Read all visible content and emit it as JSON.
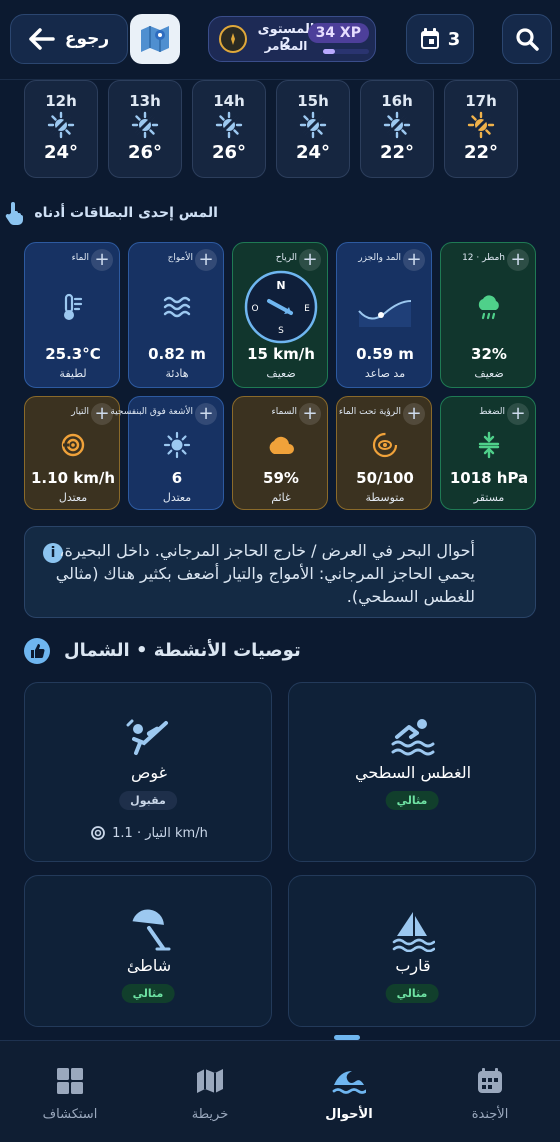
{
  "header": {
    "back_label": "رجوع",
    "level_label": "المستوى 2",
    "level_title": "المغامر",
    "xp": "34 XP",
    "xp_progress": 0.25,
    "calendar_count": "3"
  },
  "hourly": [
    {
      "hour": "12h",
      "temp": "24°",
      "icon": "partly-sunny-icon"
    },
    {
      "hour": "13h",
      "temp": "26°",
      "icon": "partly-sunny-icon"
    },
    {
      "hour": "14h",
      "temp": "26°",
      "icon": "partly-sunny-icon"
    },
    {
      "hour": "15h",
      "temp": "24°",
      "icon": "partly-sunny-icon"
    },
    {
      "hour": "16h",
      "temp": "22°",
      "icon": "partly-sunny-icon"
    },
    {
      "hour": "17h",
      "temp": "22°",
      "icon": "sun-icon"
    }
  ],
  "hint": "المس إحدى البطاقات أدناه",
  "metrics_row1": [
    {
      "name": "الماء",
      "value": "25.3°C",
      "sub": "لطيفة",
      "icon": "thermometer-icon",
      "color": "blue"
    },
    {
      "name": "الأمواج",
      "value": "0.82 m",
      "sub": "هادئة",
      "icon": "waves-icon",
      "color": "blue"
    },
    {
      "name": "الرياح",
      "value": "15 km/h",
      "sub": "ضعيف",
      "icon": "wind-compass-icon",
      "color": "green",
      "compass": {
        "n": "N",
        "e": "E",
        "s": "S",
        "o": "O"
      }
    },
    {
      "name": "المد والجزر",
      "value": "0.59 m",
      "sub": "مد صاعد",
      "icon": "tide-curve-icon",
      "color": "blue"
    },
    {
      "name": "مطر · 12h",
      "value": "32%",
      "sub": "ضعيف",
      "icon": "rain-cloud-icon",
      "color": "green"
    }
  ],
  "metrics_row2": [
    {
      "name": "التيار",
      "value": "1.10 km/h",
      "sub": "معتدل",
      "icon": "current-icon",
      "color": "amber"
    },
    {
      "name": "الأشعة فوق البنفسجية",
      "value": "6",
      "sub": "معتدل",
      "icon": "uv-sun-icon",
      "color": "blue"
    },
    {
      "name": "السماء",
      "value": "59%",
      "sub": "غائم",
      "icon": "cloud-icon",
      "color": "amber"
    },
    {
      "name": "الرؤية تحت الماء",
      "value": "50/100",
      "sub": "متوسطة",
      "icon": "eye-icon",
      "color": "amber"
    },
    {
      "name": "الضغط",
      "value": "1018 hPa",
      "sub": "مستقر",
      "icon": "pressure-icon",
      "color": "green"
    }
  ],
  "info_text": "أحوال البحر في العرض / خارج الحاجز المرجاني. داخل البحيرة، يحمي الحاجز المرجاني: الأمواج والتيار أضعف بكثير هناك (مثالي للغطس السطحي).",
  "section_title": "توصيات الأنشطة • الشمال",
  "activities": [
    {
      "name": "الغطس السطحي",
      "badge": "مثالي",
      "status": "ideal",
      "icon": "snorkel-swimmer-icon"
    },
    {
      "name": "غوص",
      "badge": "مقبول",
      "status": "ok",
      "icon": "diver-icon",
      "extra": "التيار · 1.1 km/h"
    },
    {
      "name": "قارب",
      "badge": "مثالي",
      "status": "ideal",
      "icon": "sailboat-icon"
    },
    {
      "name": "شاطئ",
      "badge": "مثالي",
      "status": "ideal",
      "icon": "beach-umbrella-icon"
    }
  ],
  "bottom_nav": [
    {
      "label": "الأجندة",
      "icon": "calendar-icon"
    },
    {
      "label": "الأحوال",
      "icon": "wave-icon",
      "active": true
    },
    {
      "label": "خريطة",
      "icon": "map-icon"
    },
    {
      "label": "استكشاف",
      "icon": "grid-icon"
    }
  ],
  "colors": {
    "background": "#0c1a30",
    "card_blue": "#173263",
    "card_green": "#11362d",
    "card_amber": "#3b3220",
    "accent": "#6fb6f0",
    "ideal": "#6ee2a3"
  }
}
